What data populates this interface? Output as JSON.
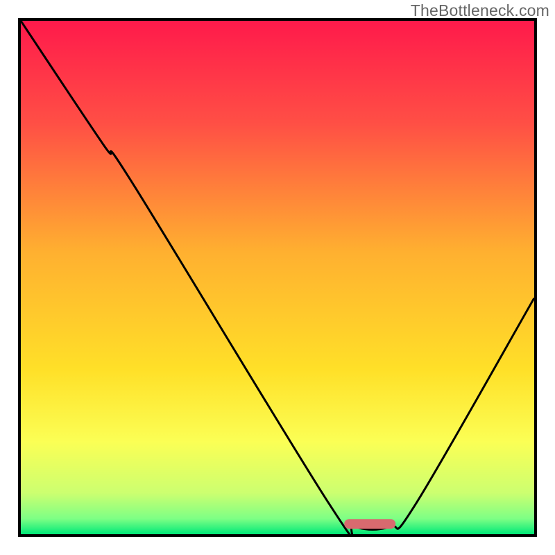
{
  "watermark": "TheBottleneck.com",
  "chart_data": {
    "type": "line",
    "title": "",
    "xlabel": "",
    "ylabel": "",
    "xlim": [
      0,
      100
    ],
    "ylim": [
      0,
      100
    ],
    "legend": "none",
    "background_gradient_stops": [
      {
        "offset": 0.0,
        "color": "#ff1a4b"
      },
      {
        "offset": 0.2,
        "color": "#ff4f45"
      },
      {
        "offset": 0.45,
        "color": "#ffb030"
      },
      {
        "offset": 0.68,
        "color": "#ffe028"
      },
      {
        "offset": 0.82,
        "color": "#fbff55"
      },
      {
        "offset": 0.92,
        "color": "#ccff70"
      },
      {
        "offset": 0.97,
        "color": "#7dff85"
      },
      {
        "offset": 1.0,
        "color": "#00e878"
      }
    ],
    "curve_points": [
      {
        "x": 0,
        "y": 100
      },
      {
        "x": 16,
        "y": 76
      },
      {
        "x": 22,
        "y": 68
      },
      {
        "x": 60,
        "y": 6
      },
      {
        "x": 65,
        "y": 1.5
      },
      {
        "x": 72,
        "y": 1.5
      },
      {
        "x": 77,
        "y": 6
      },
      {
        "x": 100,
        "y": 46
      }
    ],
    "marker": {
      "x_start": 63,
      "x_end": 73,
      "y": 2,
      "color": "#d86a6f"
    }
  }
}
